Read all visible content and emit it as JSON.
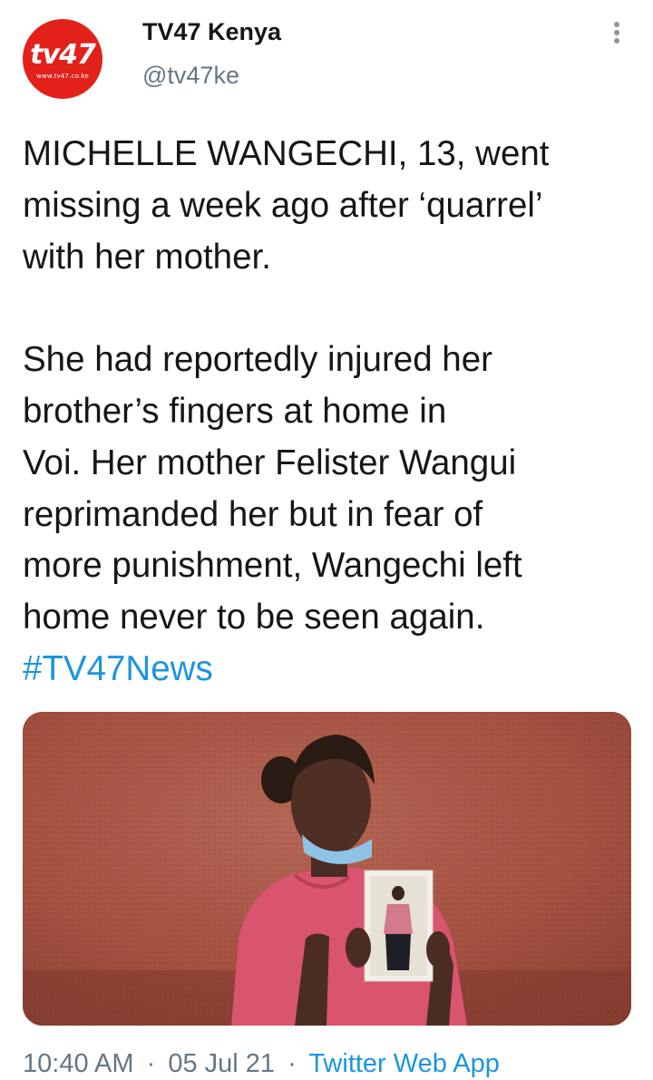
{
  "author": {
    "display_name": "TV47 Kenya",
    "handle": "@tv47ke",
    "avatar_logo": "tv47",
    "avatar_url_text": "www.tv47.co.ke"
  },
  "tweet": {
    "paragraph1": "MICHELLE WANGECHI, 13, went\nmissing a week ago after ‘quarrel’\nwith her mother.",
    "paragraph2": "She had reportedly injured her\nbrother’s fingers at home in\nVoi. Her mother Felister Wangui\nreprimanded her but in fear of\nmore punishment, Wangechi left\nhome never to be seen again.",
    "hashtag": "#TV47News"
  },
  "meta": {
    "time": "10:40 AM",
    "date": "05 Jul 21",
    "source": "Twitter Web App",
    "separator": "·"
  },
  "colors": {
    "brand_red": "#e3211b",
    "link_blue": "#1b95e0",
    "secondary_gray": "#657786"
  },
  "icons": {
    "more": "vertical-ellipsis-icon"
  }
}
